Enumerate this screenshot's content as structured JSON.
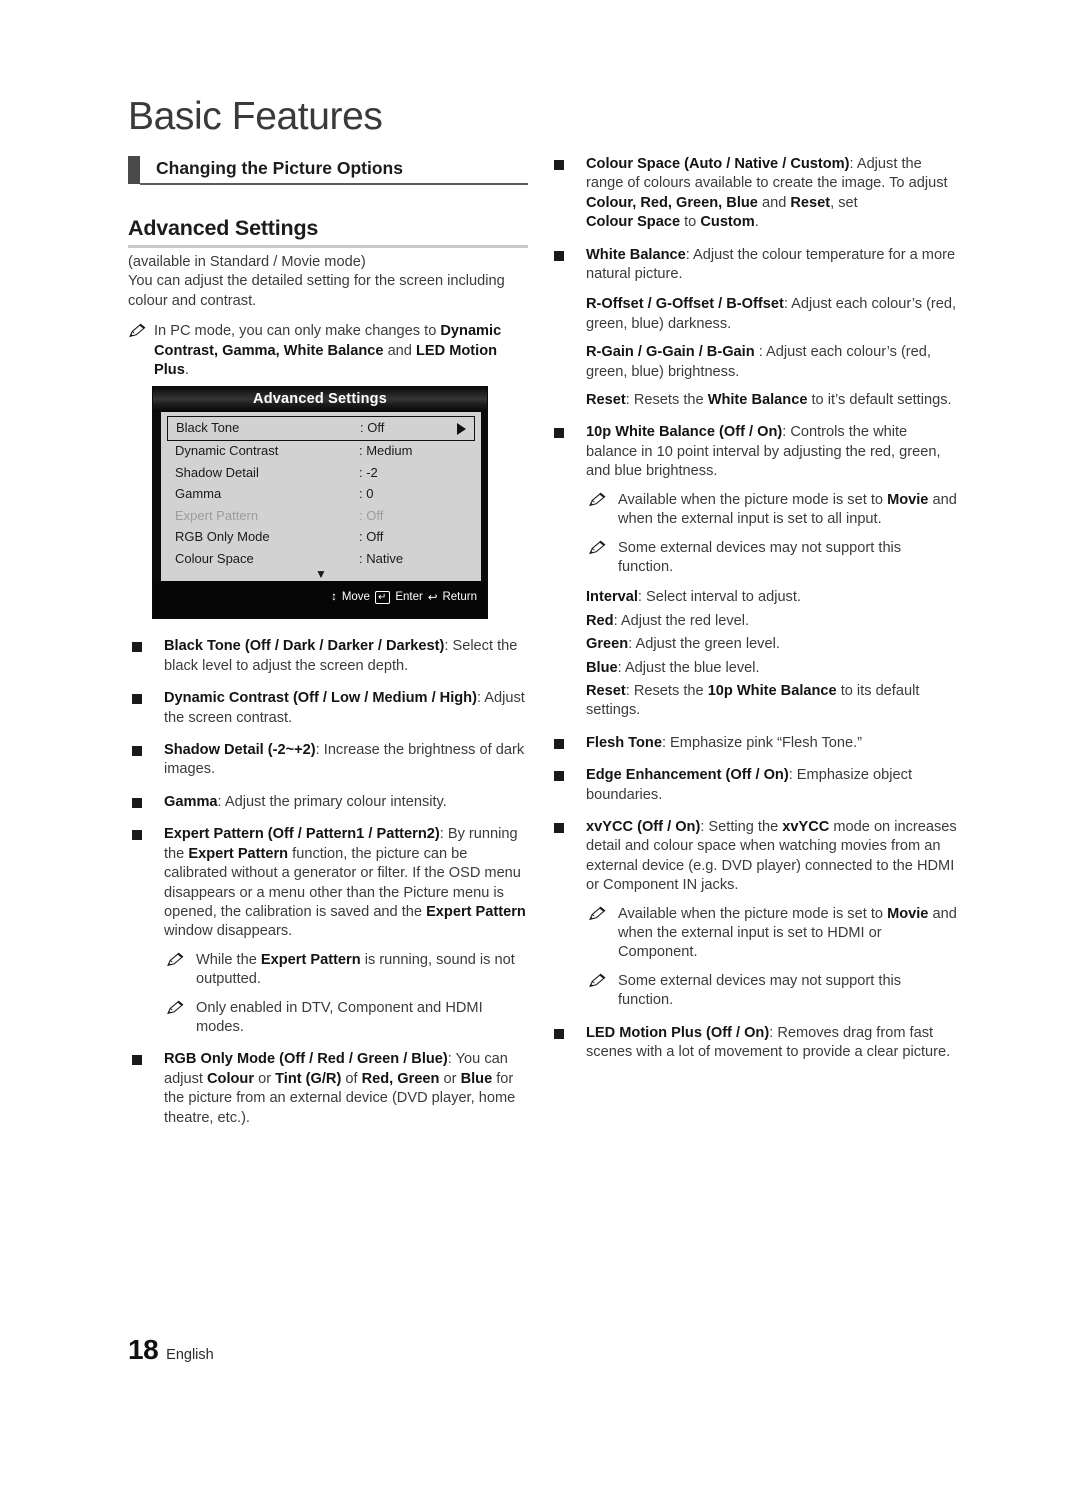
{
  "chapter": {
    "title": "Basic Features"
  },
  "section": {
    "label": "Changing the Picture Options"
  },
  "subsection": {
    "title": "Advanced Settings"
  },
  "left_column": {
    "availability": "(available in Standard / Movie mode)",
    "intro": "You can adjust the detailed setting for the screen including colour and contrast.",
    "pc_note_a": "In PC mode, you can only make changes to ",
    "pc_note_b": "Dynamic Contrast, Gamma, White Balance",
    "pc_note_c": " and ",
    "pc_note_d": "LED Motion Plus",
    "pc_note_e": ".",
    "bullets": {
      "black_tone_term": "Black Tone (Off / Dark / Darker / Darkest)",
      "black_tone_desc": ": Select the black level to adjust the screen depth.",
      "dynamic_contrast_term": "Dynamic Contrast (Off / Low / Medium / High)",
      "dynamic_contrast_desc": ": Adjust the screen contrast.",
      "shadow_detail_term": "Shadow Detail (-2~+2)",
      "shadow_detail_desc": ": Increase the brightness of dark images.",
      "gamma_term": "Gamma",
      "gamma_desc": ": Adjust the primary colour intensity.",
      "expert_pattern_term": "Expert Pattern (Off / Pattern1 / Pattern2)",
      "expert_pattern_d1": ": By running the ",
      "expert_pattern_b1": "Expert Pattern",
      "expert_pattern_d2": " function, the picture can be calibrated without a generator or filter. If the OSD menu disappears or a menu other than the Picture menu is opened, the calibration is saved and the ",
      "expert_pattern_b2": "Expert Pattern",
      "expert_pattern_d3": " window disappears.",
      "ep_note1_a": "While the ",
      "ep_note1_b": "Expert Pattern",
      "ep_note1_c": " is running, sound is not outputted.",
      "ep_note2": "Only enabled in DTV, Component and HDMI modes.",
      "rgb_only_term": "RGB Only Mode (Off / Red / Green / Blue)",
      "rgb_only_d1": ": You can adjust ",
      "rgb_only_b1": "Colour",
      "rgb_only_d2": " or ",
      "rgb_only_b2": "Tint (G/R)",
      "rgb_only_d3": " of ",
      "rgb_only_b3": "Red, Green",
      "rgb_only_d4": " or ",
      "rgb_only_b4": "Blue",
      "rgb_only_d5": " for the picture from an external device (DVD player, home theatre, etc.)."
    }
  },
  "osd": {
    "title": "Advanced Settings",
    "rows": [
      {
        "name": "Black Tone",
        "value": ": Off"
      },
      {
        "name": "Dynamic Contrast",
        "value": ": Medium"
      },
      {
        "name": "Shadow Detail",
        "value": ": -2"
      },
      {
        "name": "Gamma",
        "value": ": 0"
      },
      {
        "name": "Expert Pattern",
        "value": ": Off"
      },
      {
        "name": "RGB Only Mode",
        "value": ": Off"
      },
      {
        "name": "Colour Space",
        "value": ": Native"
      }
    ],
    "scroll_indicator": "▼",
    "footer": {
      "move_icon": "↕",
      "move_label": "Move",
      "enter_icon": "↵",
      "enter_label": "Enter",
      "return_icon": "↩",
      "return_label": "Return"
    }
  },
  "right_column": {
    "colour_space_term": "Colour Space (Auto / Native / Custom)",
    "colour_space_d1": ": Adjust the range of colours available to create the image. To adjust ",
    "colour_space_b1": "Colour, Red, Green, Blue",
    "colour_space_d2": " and ",
    "colour_space_b2": "Reset",
    "colour_space_d3": ", set ",
    "colour_space_b3": "Colour Space",
    "colour_space_d4": " to ",
    "colour_space_b4": "Custom",
    "colour_space_d5": ".",
    "white_balance_term": "White Balance",
    "white_balance_desc": ": Adjust the colour temperature for a more natural picture.",
    "offset_term": "R-Offset / G-Offset / B-Offset",
    "offset_desc": ": Adjust each colour’s (red, green, blue) darkness.",
    "gain_term": "R-Gain / G-Gain / B-Gain",
    "gain_desc": " : Adjust each colour’s (red, green, blue) brightness.",
    "reset_wb_term": "Reset",
    "reset_wb_d1": ": Resets the ",
    "reset_wb_b1": "White Balance",
    "reset_wb_d2": " to it’s default settings.",
    "tenp_term": "10p White Balance (Off / On)",
    "tenp_desc": ": Controls the white balance in 10 point interval by adjusting the red, green, and blue brightness.",
    "tenp_note1_a": "Available when the picture mode is set to ",
    "tenp_note1_b": "Movie",
    "tenp_note1_c": " and when the external input is set to all input.",
    "tenp_note2": "Some external devices may not support this function.",
    "interval_term": "Interval",
    "interval_desc": ": Select interval to adjust.",
    "red_term": "Red",
    "red_desc": ": Adjust the red level.",
    "green_term": "Green",
    "green_desc": ": Adjust the green level.",
    "blue_term": "Blue",
    "blue_desc": ": Adjust the blue level.",
    "reset10p_term": "Reset",
    "reset10p_d1": ": Resets the ",
    "reset10p_b1": "10p White Balance",
    "reset10p_d2": " to its default settings.",
    "flesh_tone_term": "Flesh Tone",
    "flesh_tone_desc": ": Emphasize pink “Flesh Tone.”",
    "edge_term": "Edge Enhancement (Off / On)",
    "edge_desc": ": Emphasize object boundaries.",
    "xvycc_term": "xvYCC (Off / On)",
    "xvycc_d1": ": Setting the ",
    "xvycc_b1": "xvYCC",
    "xvycc_d2": " mode on increases detail and colour space when watching movies from an external device (e.g. DVD player) connected to the HDMI or Component IN jacks.",
    "xvycc_note1_a": "Available when the picture mode is set to ",
    "xvycc_note1_b": "Movie",
    "xvycc_note1_c": " and when the external input is set to HDMI or Component.",
    "xvycc_note2": "Some external devices may not support this function.",
    "led_term": "LED Motion Plus (Off / On)",
    "led_desc": ": Removes drag from fast scenes with a lot of movement to provide a clear picture."
  },
  "footer": {
    "page_number": "18",
    "language": "English"
  }
}
